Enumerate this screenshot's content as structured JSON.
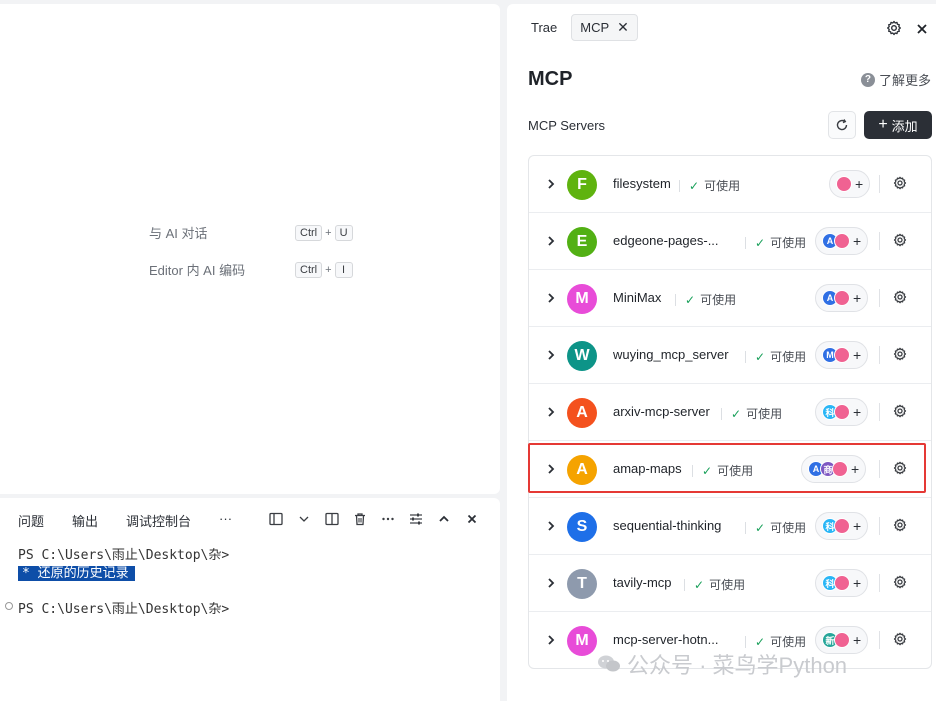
{
  "editor": {
    "shortcuts": [
      {
        "label": "与 AI 对话",
        "keys": [
          "Ctrl",
          "U"
        ]
      },
      {
        "label": "Editor 内 AI 编码",
        "keys": [
          "Ctrl",
          "I"
        ]
      }
    ],
    "plus": "+"
  },
  "terminal": {
    "tabs": [
      "问题",
      "输出",
      "调试控制台",
      "···"
    ],
    "lines": [
      "PS C:\\Users\\雨止\\Desktop\\杂>",
      "* 还原的历史记录",
      "PS C:\\Users\\雨止\\Desktop\\杂>"
    ]
  },
  "panel": {
    "tabs": [
      "Trae",
      "MCP"
    ],
    "title": "MCP",
    "learn_more": "了解更多",
    "servers_label": "MCP Servers",
    "add_label": "添加",
    "servers": [
      {
        "letter": "F",
        "name": "filesystem",
        "status": "可使用",
        "color": "#5fb30f",
        "badges": [
          {
            "t": "",
            "c": "#f06292",
            "kind": "tool"
          }
        ]
      },
      {
        "letter": "E",
        "name": "edgeone-pages-...",
        "status": "可使用",
        "color": "#52b014",
        "badges": [
          {
            "t": "A",
            "c": "#2f6fe4"
          },
          {
            "t": "",
            "c": "#f06292",
            "kind": "tool"
          }
        ]
      },
      {
        "letter": "M",
        "name": "MiniMax",
        "status": "可使用",
        "color": "#e84cd8",
        "badges": [
          {
            "t": "A",
            "c": "#2f6fe4"
          },
          {
            "t": "",
            "c": "#f06292",
            "kind": "tool"
          }
        ]
      },
      {
        "letter": "W",
        "name": "wuying_mcp_server",
        "status": "可使用",
        "color": "#0d9488",
        "badges": [
          {
            "t": "M",
            "c": "#2f6fe4"
          },
          {
            "t": "",
            "c": "#f06292",
            "kind": "tool"
          }
        ]
      },
      {
        "letter": "A",
        "name": "arxiv-mcp-server",
        "status": "可使用",
        "color": "#f4511e",
        "badges": [
          {
            "t": "科",
            "c": "#29b6f6"
          },
          {
            "t": "",
            "c": "#f06292",
            "kind": "tool"
          }
        ]
      },
      {
        "letter": "A",
        "name": "amap-maps",
        "status": "可使用",
        "color": "#f5a300",
        "badges": [
          {
            "t": "A",
            "c": "#2f6fe4"
          },
          {
            "t": "商",
            "c": "#7e57c2"
          },
          {
            "t": "",
            "c": "#f06292",
            "kind": "tool"
          }
        ]
      },
      {
        "letter": "S",
        "name": "sequential-thinking",
        "status": "可使用",
        "color": "#1e6fe8",
        "badges": [
          {
            "t": "科",
            "c": "#29b6f6"
          },
          {
            "t": "",
            "c": "#f06292",
            "kind": "tool"
          }
        ]
      },
      {
        "letter": "T",
        "name": "tavily-mcp",
        "status": "可使用",
        "color": "#8e9aad",
        "badges": [
          {
            "t": "科",
            "c": "#29b6f6"
          },
          {
            "t": "",
            "c": "#f06292",
            "kind": "tool"
          }
        ]
      },
      {
        "letter": "M",
        "name": "mcp-server-hotn...",
        "status": "可使用",
        "color": "#e84cd8",
        "badges": [
          {
            "t": "新",
            "c": "#26a69a"
          },
          {
            "t": "",
            "c": "#f06292",
            "kind": "tool"
          }
        ]
      }
    ]
  },
  "watermark": "公众号 · 菜鸟学Python"
}
